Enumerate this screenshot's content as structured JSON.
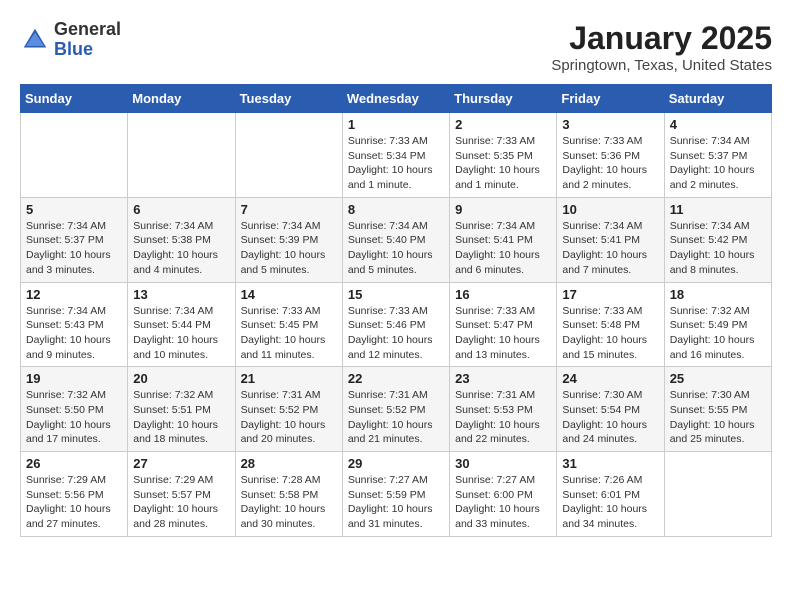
{
  "header": {
    "logo_general": "General",
    "logo_blue": "Blue",
    "title": "January 2025",
    "subtitle": "Springtown, Texas, United States"
  },
  "days_of_week": [
    "Sunday",
    "Monday",
    "Tuesday",
    "Wednesday",
    "Thursday",
    "Friday",
    "Saturday"
  ],
  "weeks": [
    [
      {
        "num": "",
        "sunrise": "",
        "sunset": "",
        "daylight": ""
      },
      {
        "num": "",
        "sunrise": "",
        "sunset": "",
        "daylight": ""
      },
      {
        "num": "",
        "sunrise": "",
        "sunset": "",
        "daylight": ""
      },
      {
        "num": "1",
        "sunrise": "Sunrise: 7:33 AM",
        "sunset": "Sunset: 5:34 PM",
        "daylight": "Daylight: 10 hours and 1 minute."
      },
      {
        "num": "2",
        "sunrise": "Sunrise: 7:33 AM",
        "sunset": "Sunset: 5:35 PM",
        "daylight": "Daylight: 10 hours and 1 minute."
      },
      {
        "num": "3",
        "sunrise": "Sunrise: 7:33 AM",
        "sunset": "Sunset: 5:36 PM",
        "daylight": "Daylight: 10 hours and 2 minutes."
      },
      {
        "num": "4",
        "sunrise": "Sunrise: 7:34 AM",
        "sunset": "Sunset: 5:37 PM",
        "daylight": "Daylight: 10 hours and 2 minutes."
      }
    ],
    [
      {
        "num": "5",
        "sunrise": "Sunrise: 7:34 AM",
        "sunset": "Sunset: 5:37 PM",
        "daylight": "Daylight: 10 hours and 3 minutes."
      },
      {
        "num": "6",
        "sunrise": "Sunrise: 7:34 AM",
        "sunset": "Sunset: 5:38 PM",
        "daylight": "Daylight: 10 hours and 4 minutes."
      },
      {
        "num": "7",
        "sunrise": "Sunrise: 7:34 AM",
        "sunset": "Sunset: 5:39 PM",
        "daylight": "Daylight: 10 hours and 5 minutes."
      },
      {
        "num": "8",
        "sunrise": "Sunrise: 7:34 AM",
        "sunset": "Sunset: 5:40 PM",
        "daylight": "Daylight: 10 hours and 5 minutes."
      },
      {
        "num": "9",
        "sunrise": "Sunrise: 7:34 AM",
        "sunset": "Sunset: 5:41 PM",
        "daylight": "Daylight: 10 hours and 6 minutes."
      },
      {
        "num": "10",
        "sunrise": "Sunrise: 7:34 AM",
        "sunset": "Sunset: 5:41 PM",
        "daylight": "Daylight: 10 hours and 7 minutes."
      },
      {
        "num": "11",
        "sunrise": "Sunrise: 7:34 AM",
        "sunset": "Sunset: 5:42 PM",
        "daylight": "Daylight: 10 hours and 8 minutes."
      }
    ],
    [
      {
        "num": "12",
        "sunrise": "Sunrise: 7:34 AM",
        "sunset": "Sunset: 5:43 PM",
        "daylight": "Daylight: 10 hours and 9 minutes."
      },
      {
        "num": "13",
        "sunrise": "Sunrise: 7:34 AM",
        "sunset": "Sunset: 5:44 PM",
        "daylight": "Daylight: 10 hours and 10 minutes."
      },
      {
        "num": "14",
        "sunrise": "Sunrise: 7:33 AM",
        "sunset": "Sunset: 5:45 PM",
        "daylight": "Daylight: 10 hours and 11 minutes."
      },
      {
        "num": "15",
        "sunrise": "Sunrise: 7:33 AM",
        "sunset": "Sunset: 5:46 PM",
        "daylight": "Daylight: 10 hours and 12 minutes."
      },
      {
        "num": "16",
        "sunrise": "Sunrise: 7:33 AM",
        "sunset": "Sunset: 5:47 PM",
        "daylight": "Daylight: 10 hours and 13 minutes."
      },
      {
        "num": "17",
        "sunrise": "Sunrise: 7:33 AM",
        "sunset": "Sunset: 5:48 PM",
        "daylight": "Daylight: 10 hours and 15 minutes."
      },
      {
        "num": "18",
        "sunrise": "Sunrise: 7:32 AM",
        "sunset": "Sunset: 5:49 PM",
        "daylight": "Daylight: 10 hours and 16 minutes."
      }
    ],
    [
      {
        "num": "19",
        "sunrise": "Sunrise: 7:32 AM",
        "sunset": "Sunset: 5:50 PM",
        "daylight": "Daylight: 10 hours and 17 minutes."
      },
      {
        "num": "20",
        "sunrise": "Sunrise: 7:32 AM",
        "sunset": "Sunset: 5:51 PM",
        "daylight": "Daylight: 10 hours and 18 minutes."
      },
      {
        "num": "21",
        "sunrise": "Sunrise: 7:31 AM",
        "sunset": "Sunset: 5:52 PM",
        "daylight": "Daylight: 10 hours and 20 minutes."
      },
      {
        "num": "22",
        "sunrise": "Sunrise: 7:31 AM",
        "sunset": "Sunset: 5:52 PM",
        "daylight": "Daylight: 10 hours and 21 minutes."
      },
      {
        "num": "23",
        "sunrise": "Sunrise: 7:31 AM",
        "sunset": "Sunset: 5:53 PM",
        "daylight": "Daylight: 10 hours and 22 minutes."
      },
      {
        "num": "24",
        "sunrise": "Sunrise: 7:30 AM",
        "sunset": "Sunset: 5:54 PM",
        "daylight": "Daylight: 10 hours and 24 minutes."
      },
      {
        "num": "25",
        "sunrise": "Sunrise: 7:30 AM",
        "sunset": "Sunset: 5:55 PM",
        "daylight": "Daylight: 10 hours and 25 minutes."
      }
    ],
    [
      {
        "num": "26",
        "sunrise": "Sunrise: 7:29 AM",
        "sunset": "Sunset: 5:56 PM",
        "daylight": "Daylight: 10 hours and 27 minutes."
      },
      {
        "num": "27",
        "sunrise": "Sunrise: 7:29 AM",
        "sunset": "Sunset: 5:57 PM",
        "daylight": "Daylight: 10 hours and 28 minutes."
      },
      {
        "num": "28",
        "sunrise": "Sunrise: 7:28 AM",
        "sunset": "Sunset: 5:58 PM",
        "daylight": "Daylight: 10 hours and 30 minutes."
      },
      {
        "num": "29",
        "sunrise": "Sunrise: 7:27 AM",
        "sunset": "Sunset: 5:59 PM",
        "daylight": "Daylight: 10 hours and 31 minutes."
      },
      {
        "num": "30",
        "sunrise": "Sunrise: 7:27 AM",
        "sunset": "Sunset: 6:00 PM",
        "daylight": "Daylight: 10 hours and 33 minutes."
      },
      {
        "num": "31",
        "sunrise": "Sunrise: 7:26 AM",
        "sunset": "Sunset: 6:01 PM",
        "daylight": "Daylight: 10 hours and 34 minutes."
      },
      {
        "num": "",
        "sunrise": "",
        "sunset": "",
        "daylight": ""
      }
    ]
  ]
}
